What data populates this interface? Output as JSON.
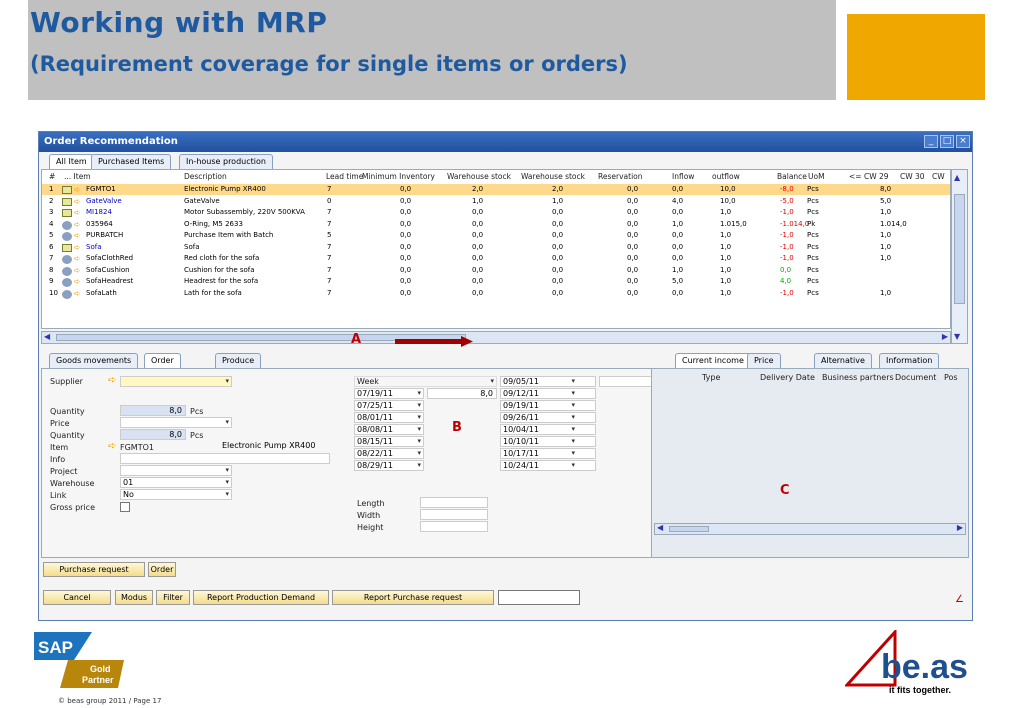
{
  "slide": {
    "title": "Working with MRP",
    "subtitle": "(Requirement coverage for single items or orders)",
    "footer": "© beas group 2011 / Page 17",
    "brand_color": "#1f5aa0",
    "accent_color": "#f0a800"
  },
  "window": {
    "title": "Order Recommendation",
    "tabs": [
      "All Item",
      "Purchased Items",
      "In-house production"
    ]
  },
  "grid": {
    "headers": [
      "#",
      "... Item",
      "Description",
      "Lead time",
      "Minimum Inventory",
      "Warehouse stock",
      "Warehouse stock",
      "Reservation",
      "Inflow",
      "outflow",
      "Balance",
      "UoM",
      "<= CW 29",
      "CW 30",
      "CW"
    ],
    "rows": [
      {
        "n": "1",
        "icon": "folder-icon",
        "item": "FGMTO1",
        "desc": "Electronic Pump XR400",
        "lead": "7",
        "min": "0,0",
        "ws1": "2,0",
        "ws2": "2,0",
        "res": "0,0",
        "in": "0,0",
        "out": "10,0",
        "bal": "-8,0",
        "uom": "Pcs",
        "cw29": "8,0"
      },
      {
        "n": "2",
        "icon": "folder-icon",
        "item": "GateValve",
        "desc": "GateValve",
        "lead": "0",
        "min": "0,0",
        "ws1": "1,0",
        "ws2": "1,0",
        "res": "0,0",
        "in": "4,0",
        "out": "10,0",
        "bal": "-5,0",
        "uom": "Pcs",
        "cw29": "5,0"
      },
      {
        "n": "3",
        "icon": "folder-icon",
        "item": "MI1824",
        "desc": "Motor Subassembly, 220V 500KVA",
        "lead": "7",
        "min": "0,0",
        "ws1": "0,0",
        "ws2": "0,0",
        "res": "0,0",
        "in": "0,0",
        "out": "1,0",
        "bal": "-1,0",
        "uom": "Pcs",
        "cw29": "1,0"
      },
      {
        "n": "4",
        "icon": "gear-icon",
        "item": "035964",
        "desc": "O-Ring, M5 2633",
        "lead": "7",
        "min": "0,0",
        "ws1": "0,0",
        "ws2": "0,0",
        "res": "0,0",
        "in": "1,0",
        "out": "1.015,0",
        "bal": "-1.014,0",
        "uom": "Pk",
        "cw29": "1.014,0"
      },
      {
        "n": "5",
        "icon": "gear-icon",
        "item": "PURBATCH",
        "desc": "Purchase Item with Batch",
        "lead": "5",
        "min": "0,0",
        "ws1": "0,0",
        "ws2": "0,0",
        "res": "0,0",
        "in": "0,0",
        "out": "1,0",
        "bal": "-1,0",
        "uom": "Pcs",
        "cw29": "1,0"
      },
      {
        "n": "6",
        "icon": "folder-icon",
        "item": "Sofa",
        "desc": "Sofa",
        "lead": "7",
        "min": "0,0",
        "ws1": "0,0",
        "ws2": "0,0",
        "res": "0,0",
        "in": "0,0",
        "out": "1,0",
        "bal": "-1,0",
        "uom": "Pcs",
        "cw29": "1,0"
      },
      {
        "n": "7",
        "icon": "gear-icon",
        "item": "SofaClothRed",
        "desc": "Red cloth for the sofa",
        "lead": "7",
        "min": "0,0",
        "ws1": "0,0",
        "ws2": "0,0",
        "res": "0,0",
        "in": "0,0",
        "out": "1,0",
        "bal": "-1,0",
        "uom": "Pcs",
        "cw29": "1,0"
      },
      {
        "n": "8",
        "icon": "gear-icon",
        "item": "SofaCushion",
        "desc": "Cushion for the sofa",
        "lead": "7",
        "min": "0,0",
        "ws1": "0,0",
        "ws2": "0,0",
        "res": "0,0",
        "in": "1,0",
        "out": "1,0",
        "bal": "0,0",
        "uom": "Pcs",
        "cw29": ""
      },
      {
        "n": "9",
        "icon": "gear-icon",
        "item": "SofaHeadrest",
        "desc": "Headrest for the sofa",
        "lead": "7",
        "min": "0,0",
        "ws1": "0,0",
        "ws2": "0,0",
        "res": "0,0",
        "in": "5,0",
        "out": "1,0",
        "bal": "4,0",
        "uom": "Pcs",
        "cw29": ""
      },
      {
        "n": "10",
        "icon": "gear-icon",
        "item": "SofaLath",
        "desc": "Lath for the sofa",
        "lead": "7",
        "min": "0,0",
        "ws1": "0,0",
        "ws2": "0,0",
        "res": "0,0",
        "in": "0,0",
        "out": "1,0",
        "bal": "-1,0",
        "uom": "Pcs",
        "cw29": "1,0"
      }
    ]
  },
  "annotations": {
    "a": "A",
    "b": "B",
    "c": "C"
  },
  "lower_tabs": [
    "Goods movements",
    "Order",
    "Produce"
  ],
  "form": {
    "supplier_label": "Supplier",
    "quantity_label": "Quantity",
    "quantity_value": "8,0",
    "quantity_uom": "Pcs",
    "price_label": "Price",
    "quantity2_label": "Quantity",
    "quantity2_value": "8,0",
    "quantity2_uom": "Pcs",
    "item_label": "Item",
    "item_value": "FGMTO1",
    "item_desc": "Electronic Pump XR400",
    "info_label": "Info",
    "project_label": "Project",
    "warehouse_label": "Warehouse",
    "warehouse_value": "01",
    "link_label": "Link",
    "link_value": "No",
    "gross_label": "Gross price"
  },
  "weeks": {
    "header_label": "Week",
    "col1": [
      "07/19/11",
      "07/25/11",
      "08/01/11",
      "08/08/11",
      "08/15/11",
      "08/22/11",
      "08/29/11"
    ],
    "col2_first_qty": "8,0",
    "col2": [
      "09/05/11",
      "09/12/11",
      "09/19/11",
      "09/26/11",
      "10/04/11",
      "10/10/11",
      "10/17/11",
      "10/24/11"
    ]
  },
  "dims": {
    "length": "Length",
    "width": "Width",
    "height": "Height"
  },
  "right_tabs": [
    "Current income",
    "Price",
    "Alternative",
    "Information"
  ],
  "right_headers": [
    "Type",
    "Delivery Date",
    "Business partners",
    "Document",
    "Pos"
  ],
  "buttons": {
    "purchase_request": "Purchase request",
    "order": "Order",
    "cancel": "Cancel",
    "modus": "Modus",
    "filter": "Filter",
    "report_prod": "Report Production Demand",
    "report_purch": "Report Purchase request"
  },
  "logos": {
    "sap": "SAP",
    "gold": "Gold",
    "partner": "Partner",
    "beas": "be.as",
    "tagline": "it fits together."
  }
}
